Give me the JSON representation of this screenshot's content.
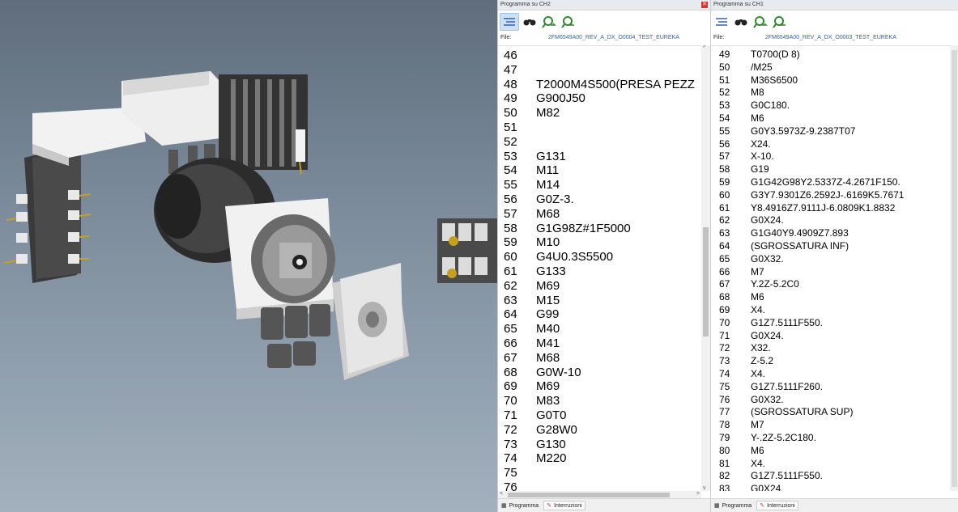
{
  "ch2": {
    "title": "Programma su CH2",
    "file_label": "File:",
    "file_name": "2FM6549A00_REV_A_DX_O0004_TEST_EUREKA",
    "lines": [
      {
        "n": "46",
        "t": ""
      },
      {
        "n": "47",
        "t": ""
      },
      {
        "n": "48",
        "t": "T2000M4S500(PRESA PEZZ"
      },
      {
        "n": "49",
        "t": "G900J50"
      },
      {
        "n": "50",
        "t": "M82"
      },
      {
        "n": "51",
        "t": ""
      },
      {
        "n": "52",
        "t": ""
      },
      {
        "n": "53",
        "t": "G131"
      },
      {
        "n": "54",
        "t": "M11"
      },
      {
        "n": "55",
        "t": "M14"
      },
      {
        "n": "56",
        "t": "G0Z-3."
      },
      {
        "n": "57",
        "t": "M68"
      },
      {
        "n": "58",
        "t": "G1G98Z#1F5000"
      },
      {
        "n": "59",
        "t": "M10"
      },
      {
        "n": "60",
        "t": "G4U0.3S5500"
      },
      {
        "n": "61",
        "t": "G133"
      },
      {
        "n": "62",
        "t": "M69"
      },
      {
        "n": "63",
        "t": "M15"
      },
      {
        "n": "64",
        "t": "G99"
      },
      {
        "n": "65",
        "t": "M40"
      },
      {
        "n": "66",
        "t": "M41"
      },
      {
        "n": "67",
        "t": "M68"
      },
      {
        "n": "68",
        "t": "G0W-10"
      },
      {
        "n": "69",
        "t": "M69"
      },
      {
        "n": "70",
        "t": "M83"
      },
      {
        "n": "71",
        "t": "G0T0"
      },
      {
        "n": "72",
        "t": "G28W0"
      },
      {
        "n": "73",
        "t": "G130"
      },
      {
        "n": "74",
        "t": "M220"
      },
      {
        "n": "75",
        "t": ""
      },
      {
        "n": "76",
        "t": ""
      }
    ],
    "tabs": [
      "Programma",
      "Interruzioni"
    ]
  },
  "ch1": {
    "title": "Programma su CH1",
    "file_label": "File:",
    "file_name": "2FM6549A00_REV_A_DX_O0003_TEST_EUREKA",
    "lines": [
      {
        "n": "49",
        "t": "T0700(D 8)"
      },
      {
        "n": "50",
        "t": "/M25"
      },
      {
        "n": "51",
        "t": "M36S6500"
      },
      {
        "n": "52",
        "t": "M8"
      },
      {
        "n": "53",
        "t": "G0C180."
      },
      {
        "n": "54",
        "t": "M6"
      },
      {
        "n": "55",
        "t": "G0Y3.5973Z-9.2387T07"
      },
      {
        "n": "56",
        "t": "X24."
      },
      {
        "n": "57",
        "t": "X-10."
      },
      {
        "n": "58",
        "t": "G19"
      },
      {
        "n": "59",
        "t": "G1G42G98Y2.5337Z-4.2671F150."
      },
      {
        "n": "60",
        "t": "G3Y7.9301Z6.2592J-.6169K5.7671"
      },
      {
        "n": "61",
        "t": "Y8.4916Z7.9111J-6.0809K1.8832"
      },
      {
        "n": "62",
        "t": "G0X24."
      },
      {
        "n": "63",
        "t": "G1G40Y9.4909Z7.893"
      },
      {
        "n": "64",
        "t": "(SGROSSATURA INF)"
      },
      {
        "n": "65",
        "t": "G0X32."
      },
      {
        "n": "66",
        "t": "M7"
      },
      {
        "n": "67",
        "t": "Y.2Z-5.2C0"
      },
      {
        "n": "68",
        "t": "M6"
      },
      {
        "n": "69",
        "t": "X4."
      },
      {
        "n": "70",
        "t": "G1Z7.5111F550."
      },
      {
        "n": "71",
        "t": "G0X24."
      },
      {
        "n": "72",
        "t": "X32."
      },
      {
        "n": "73",
        "t": "Z-5.2"
      },
      {
        "n": "74",
        "t": "X4."
      },
      {
        "n": "75",
        "t": "G1Z7.5111F260."
      },
      {
        "n": "76",
        "t": "G0X32."
      },
      {
        "n": "77",
        "t": "(SGROSSATURA SUP)"
      },
      {
        "n": "78",
        "t": "M7"
      },
      {
        "n": "79",
        "t": "Y-.2Z-5.2C180."
      },
      {
        "n": "80",
        "t": "M6"
      },
      {
        "n": "81",
        "t": "X4."
      },
      {
        "n": "82",
        "t": "G1Z7.5111F550."
      },
      {
        "n": "83",
        "t": "G0X24."
      }
    ],
    "tabs": [
      "Programma",
      "Interruzioni"
    ]
  },
  "icons": [
    "list-view-icon",
    "binoculars-icon",
    "find-next-icon",
    "find-previous-icon"
  ],
  "colors": {
    "accent": "#2a62b8",
    "close": "#d9362b",
    "search_icon": "#2e8b2e"
  }
}
